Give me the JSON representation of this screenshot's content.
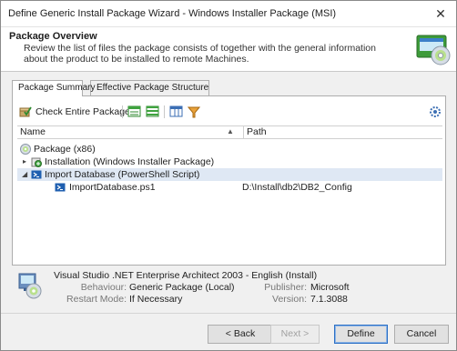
{
  "window": {
    "title": "Define Generic Install Package Wizard - Windows Installer Package (MSI)",
    "close_glyph": "✕"
  },
  "header": {
    "title": "Package Overview",
    "description": "Review the list of files the package consists of together with the general information about the product to be installed to remote Machines."
  },
  "tabs": [
    {
      "label": "Package Summary",
      "active": true
    },
    {
      "label": "Effective Package Structure",
      "active": false
    }
  ],
  "toolbar": {
    "check_entire_package": "Check Entire Package",
    "icons": [
      "check-package-icon",
      "expand-all-icon",
      "collapse-all-icon",
      "columns-icon",
      "filter-icon",
      "settings-icon"
    ]
  },
  "grid": {
    "columns": {
      "name": "Name",
      "path": "Path"
    },
    "rows": [
      {
        "name": "Package (x86)",
        "path": "",
        "icon": "package-icon",
        "expander": ""
      },
      {
        "name": "Installation (Windows Installer Package)",
        "path": "",
        "icon": "installer-icon",
        "expander": "▸"
      },
      {
        "name": "Import Database (PowerShell Script)",
        "path": "",
        "icon": "powershell-icon",
        "expander": "◢"
      },
      {
        "name": "ImportDatabase.ps1",
        "path": "D:\\Install\\db2\\DB2_Config",
        "icon": "powershell-file-icon",
        "expander": ""
      }
    ]
  },
  "details": {
    "product_title": "Visual Studio .NET Enterprise Architect 2003 - English (Install)",
    "behaviour_label": "Behaviour:",
    "behaviour_value": "Generic Package (Local)",
    "restart_label": "Restart Mode:",
    "restart_value": "If Necessary",
    "publisher_label": "Publisher:",
    "publisher_value": "Microsoft",
    "version_label": "Version:",
    "version_value": "7.1.3088"
  },
  "buttons": {
    "back": "< Back",
    "next": "Next >",
    "define": "Define",
    "cancel": "Cancel"
  },
  "colors": {
    "selected_row": "#dfe8f4",
    "accent": "#2b6fc4",
    "powershell": "#1f5fb0"
  }
}
